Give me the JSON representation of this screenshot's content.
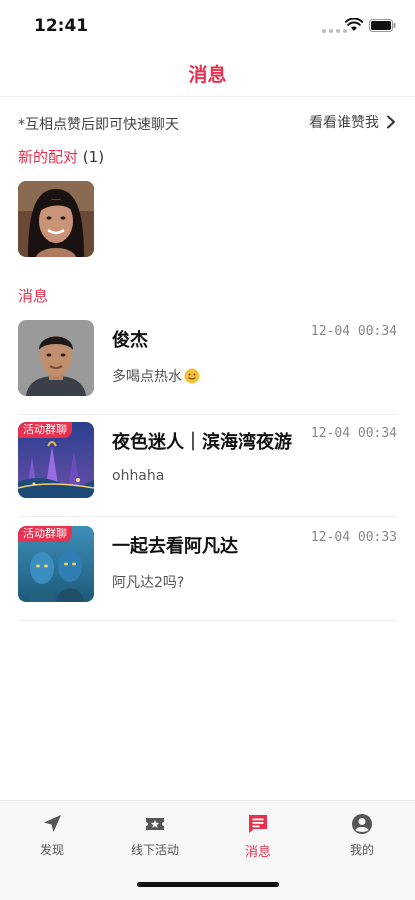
{
  "status_bar": {
    "time": "12:41",
    "icons": [
      "signal-dots",
      "wifi-icon",
      "battery-icon"
    ]
  },
  "header": {
    "title": "消息"
  },
  "hint": {
    "text": "*互相点赞后即可快速聊天",
    "likes_link": "看看谁赞我"
  },
  "matches": {
    "title": "新的配对",
    "count": "(1)",
    "items": [
      {
        "avatar": "woman-photo"
      }
    ]
  },
  "messages": {
    "title": "消息",
    "items": [
      {
        "name": "俊杰",
        "time": "12-04 00:34",
        "preview": "多喝点热水",
        "preview_emoji": "smile-emoji",
        "avatar": "man-photo",
        "badge": ""
      },
      {
        "name": "夜色迷人｜滨海湾夜游",
        "time": "12-04 00:34",
        "preview": "ohhaha",
        "avatar": "marina-bay-photo",
        "badge": "活动群聊"
      },
      {
        "name": "一起去看阿凡达",
        "time": "12-04 00:33",
        "preview": "阿凡达2吗?",
        "avatar": "avatar-movie-photo",
        "badge": "活动群聊"
      }
    ]
  },
  "tab_bar": {
    "tabs": [
      {
        "label": "发现",
        "icon": "navigation-arrow-icon",
        "active": false
      },
      {
        "label": "线下活动",
        "icon": "ticket-star-icon",
        "active": false
      },
      {
        "label": "消息",
        "icon": "chat-bubble-icon",
        "active": true
      },
      {
        "label": "我的",
        "icon": "user-circle-icon",
        "active": false
      }
    ]
  },
  "colors": {
    "accent": "#e8314e",
    "text": "#222222",
    "muted": "#888888"
  }
}
